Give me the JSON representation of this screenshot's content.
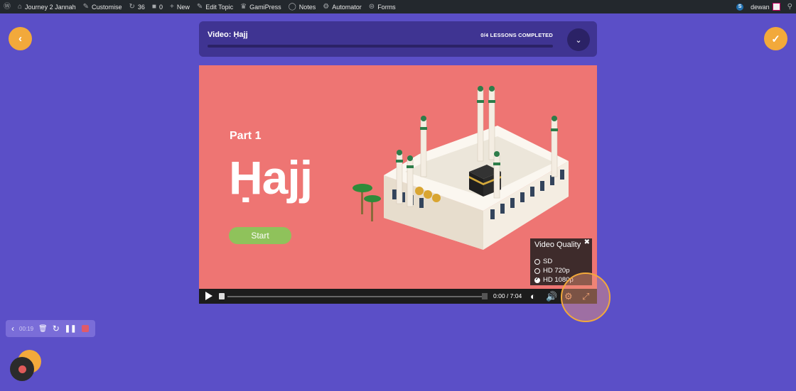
{
  "adminbar": {
    "items": [
      {
        "icon": "wordpress-icon",
        "glyph": "Ⓦ",
        "label": ""
      },
      {
        "icon": "dashboard-icon",
        "glyph": "⌂",
        "label": "Journey 2 Jannah"
      },
      {
        "icon": "brush-icon",
        "glyph": "✎",
        "label": "Customise"
      },
      {
        "icon": "updates-icon",
        "glyph": "↻",
        "label": "36"
      },
      {
        "icon": "comments-icon",
        "glyph": "■",
        "label": "0"
      },
      {
        "icon": "plus-icon",
        "glyph": "+",
        "label": "New"
      },
      {
        "icon": "pencil-icon",
        "glyph": "✎",
        "label": "Edit Topic"
      },
      {
        "icon": "crown-icon",
        "glyph": "♛",
        "label": "GamiPress"
      },
      {
        "icon": "chat-icon",
        "glyph": "◯",
        "label": "Notes"
      },
      {
        "icon": "robot-icon",
        "glyph": "⚙",
        "label": "Automator"
      },
      {
        "icon": "forms-icon",
        "glyph": "⊜",
        "label": "Forms"
      }
    ],
    "user": "dewan",
    "site_badge": "S"
  },
  "nav": {
    "prev_icon": "chevron-left-icon",
    "complete_icon": "check-icon"
  },
  "header": {
    "title": "Video: Ḥajj",
    "status": "0/4 LESSONS COMPLETED",
    "progress": 0
  },
  "video": {
    "part_label": "Part 1",
    "title": "Ḥajj",
    "start_label": "Start",
    "quality_menu": {
      "title": "Video Quality",
      "close": "✖",
      "options": [
        "SD",
        "HD 720p",
        "HD 1080p"
      ],
      "selected": "HD 1080p"
    },
    "controls": {
      "time": "0:00 / 7:04",
      "progress": 0
    }
  },
  "recorder": {
    "back": "‹",
    "time": "00:19"
  },
  "colors": {
    "background": "#5b4fc7",
    "accent": "#f2a93b",
    "video_bg": "#ee7573",
    "start_button": "#8fc25b"
  }
}
